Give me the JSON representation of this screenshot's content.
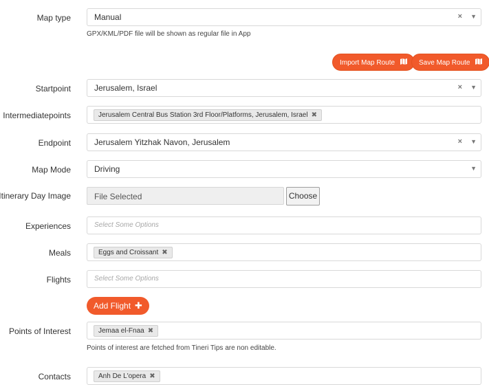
{
  "map_type": {
    "label": "Map type",
    "value": "Manual",
    "help": "GPX/KML/PDF file will be shown as regular file in App"
  },
  "map_route_buttons": {
    "import_label": "Import Map Route",
    "save_label": "Save Map Route",
    "icon": "map-icon",
    "color": "#f15a2b"
  },
  "startpoint": {
    "label": "Startpoint",
    "value": "Jerusalem, Israel"
  },
  "intermediatepoints": {
    "label": "Intermediatepoints",
    "chips": [
      "Jerusalem Central Bus Station 3rd Floor/Platforms, Jerusalem, Israel"
    ]
  },
  "endpoint": {
    "label": "Endpoint",
    "value": "Jerusalem Yitzhak Navon, Jerusalem"
  },
  "map_mode": {
    "label": "Map Mode",
    "value": "Driving"
  },
  "itinerary_image": {
    "label": "Itinerary Day Image",
    "file_text": "File Selected",
    "choose_label": "Choose"
  },
  "experiences": {
    "label": "Experiences",
    "placeholder": "Select Some Options"
  },
  "meals": {
    "label": "Meals",
    "chips": [
      "Eggs and Croissant"
    ]
  },
  "flights": {
    "label": "Flights",
    "placeholder": "Select Some Options"
  },
  "add_flight": {
    "label": "Add Flight"
  },
  "points_of_interest": {
    "label": "Points of Interest",
    "chips": [
      "Jemaa el-Fnaa"
    ],
    "help": "Points of interest are fetched from Tineri Tips are non editable."
  },
  "contacts": {
    "label": "Contacts",
    "chips": [
      "Anh De L'opera"
    ]
  },
  "icons": {
    "clear": "×",
    "caret": "▼",
    "chip_remove": "✖",
    "plus": "✚"
  }
}
